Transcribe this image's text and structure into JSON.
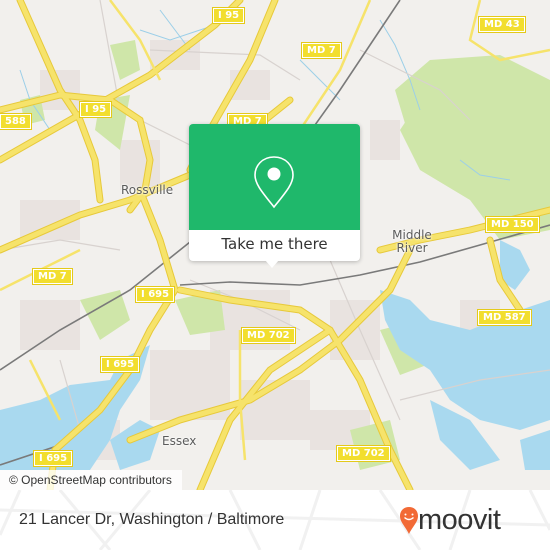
{
  "map": {
    "colors": {
      "land": "#f2f0ed",
      "water": "#a9d9ef",
      "park": "#cfe6a9",
      "urban": "#e9e3e0",
      "road_major": "#f6e36b",
      "road_stroke": "#e7c93a",
      "railway": "#7a7a7a"
    },
    "shields": [
      {
        "label": "I 95",
        "name": "shield-i95-north"
      },
      {
        "label": "I 95",
        "name": "shield-i95-west"
      },
      {
        "label": "588",
        "name": "shield-588"
      },
      {
        "label": "MD 7",
        "name": "shield-md7-north"
      },
      {
        "label": "MD 7",
        "name": "shield-md7-center"
      },
      {
        "label": "MD 43",
        "name": "shield-md43"
      },
      {
        "label": "MD 7",
        "name": "shield-md7-west"
      },
      {
        "label": "I 695",
        "name": "shield-i695-center"
      },
      {
        "label": "I 695",
        "name": "shield-i695-south"
      },
      {
        "label": "I 695",
        "name": "shield-i695-southwest"
      },
      {
        "label": "MD 702",
        "name": "shield-md702-north"
      },
      {
        "label": "MD 702",
        "name": "shield-md702-south"
      },
      {
        "label": "MD 150",
        "name": "shield-md150"
      },
      {
        "label": "MD 587",
        "name": "shield-md587"
      }
    ],
    "places": [
      {
        "label": "Rossville",
        "name": "place-rossville"
      },
      {
        "label": "Middle River",
        "name": "place-middle-river"
      },
      {
        "label": "Essex",
        "name": "place-essex"
      }
    ],
    "attribution": "© OpenStreetMap contributors"
  },
  "popup": {
    "icon": "map-pin-icon",
    "button_label": "Take me there",
    "accent": "#1fb86b"
  },
  "footer": {
    "address": "21 Lancer Dr, Washington / Baltimore",
    "logo": {
      "text": "moovit",
      "pin_color": "#f26a36",
      "icon": "moovit-smile-pin-icon"
    }
  }
}
